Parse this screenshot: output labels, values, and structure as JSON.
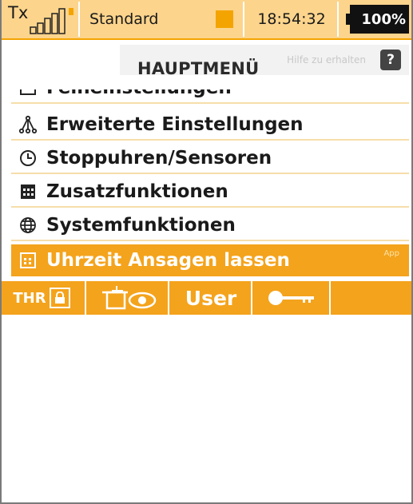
{
  "status_bar": {
    "tx_label": "Tx",
    "tx_sub": "",
    "model_name": "Standard",
    "time": "18:54:32",
    "battery": "100%"
  },
  "header": {
    "title": "HAUPTMENÜ",
    "hint_text": "Hilfe zu erhalten",
    "help_label": "?"
  },
  "menu": {
    "items": [
      {
        "label": "Feineinstellungen",
        "icon": "sliders-icon"
      },
      {
        "label": "Erweiterte Einstellungen",
        "icon": "tree-icon"
      },
      {
        "label": "Stoppuhren/Sensoren",
        "icon": "clock-icon"
      },
      {
        "label": "Zusatzfunktionen",
        "icon": "grid-icon"
      },
      {
        "label": "Systemfunktionen",
        "icon": "globe-icon"
      },
      {
        "label": "Uhrzeit Ansagen lassen",
        "icon": "calendar-icon",
        "tag": "App",
        "selected": true
      }
    ]
  },
  "toolbar": {
    "thr_label": "THR",
    "user_label": "User"
  },
  "colors": {
    "accent": "#f4a31c",
    "statusbar_bg": "#fcd48c",
    "separator": "#f6deaa"
  }
}
